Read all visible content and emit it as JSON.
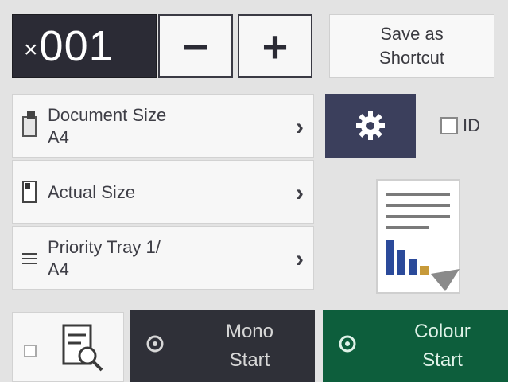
{
  "copies": {
    "prefix": "×",
    "value": "001"
  },
  "stepper": {
    "minus_label": "−",
    "plus_label": "+"
  },
  "shortcut": {
    "line1": "Save as",
    "line2": "Shortcut"
  },
  "settings": [
    {
      "line1": "Document Size",
      "line2": "A4",
      "icon": "document-size-icon"
    },
    {
      "line1": "Actual Size",
      "line2": "",
      "icon": "scale-icon"
    },
    {
      "line1": "Priority Tray 1/",
      "line2": "A4",
      "icon": "tray-icon"
    }
  ],
  "chevron": "›",
  "options_icon": "gear-icon",
  "id_copy": {
    "label": "ID"
  },
  "preview_icon": "copy-preview-icon",
  "preview_button_icon": "preview-magnifier-icon",
  "mono_start": {
    "line1": "Mono",
    "line2": "Start"
  },
  "colour_start": {
    "line1": "Colour",
    "line2": "Start"
  },
  "colors": {
    "dark": "#2b2b35",
    "gear_bg": "#3b3f5c",
    "mono_bg": "#2f3038",
    "colour_bg": "#0d5e3c",
    "chart_blue": "#2b4a9a",
    "chart_gold": "#c79a3a"
  }
}
